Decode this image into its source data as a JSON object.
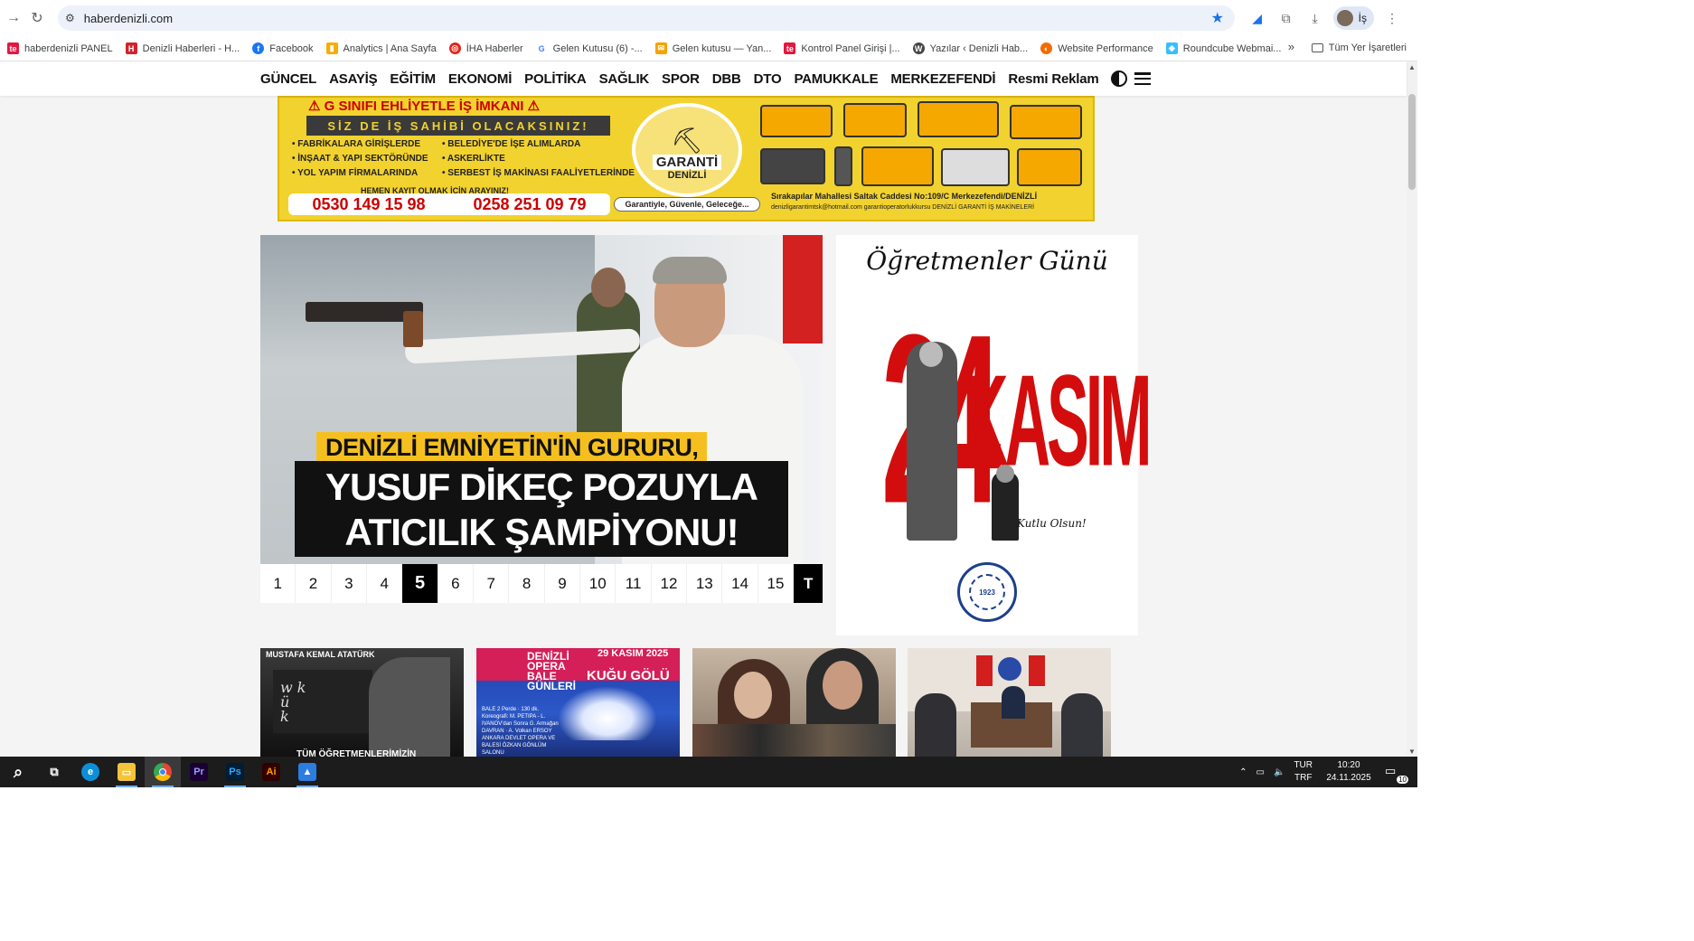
{
  "browser": {
    "url": "haberdenizli.com",
    "profile_label": "İş"
  },
  "bookmarks": {
    "items": [
      {
        "label": "haberdenizli PANEL",
        "icon": "te-icon",
        "color": "#e5173f"
      },
      {
        "label": "Denizli Haberleri - H...",
        "icon": "hd-icon",
        "color": "#d0232e"
      },
      {
        "label": "Facebook",
        "icon": "facebook-icon",
        "color": "#1877f2"
      },
      {
        "label": "Analytics | Ana Sayfa",
        "icon": "analytics-icon",
        "color": "#f9ab00"
      },
      {
        "label": "İHA Haberler",
        "icon": "iha-icon",
        "color": "#e2231a"
      },
      {
        "label": "Gelen Kutusu (6) -...",
        "icon": "google-icon",
        "color": "#4285f4"
      },
      {
        "label": "Gelen kutusu — Yan...",
        "icon": "yandex-mail-icon",
        "color": "#f5a300"
      },
      {
        "label": "Kontrol Panel Girişi |...",
        "icon": "te-icon",
        "color": "#e5173f"
      },
      {
        "label": "Yazılar ‹ Denizli Hab...",
        "icon": "wordpress-icon",
        "color": "#464646"
      },
      {
        "label": "Website Performance",
        "icon": "performance-icon",
        "color": "#f56a00"
      },
      {
        "label": "Roundcube Webmai...",
        "icon": "roundcube-icon",
        "color": "#37beff"
      }
    ],
    "more": "»",
    "all_label": "Tüm Yer İşaretleri"
  },
  "site_nav": {
    "items": [
      "GÜNCEL",
      "ASAYİŞ",
      "EĞİTİM",
      "EKONOMİ",
      "POLİTİKA",
      "SAĞLIK",
      "SPOR",
      "DBB",
      "DTO",
      "PAMUKKALE",
      "MERKEZEFENDİ",
      "Resmi Reklam"
    ]
  },
  "ad_banner": {
    "title": "⚠ G SINIFI EHLİYETLE İŞ İMKANI ⚠",
    "subtitle": "SİZ DE İŞ SAHİBİ OLACAKSINIZ!",
    "list_left": [
      "• FABRİKALARA GİRİŞLERDE",
      "• İNŞAAT & YAPI SEKTÖRÜNDE",
      "• YOL YAPIM FİRMALARINDA"
    ],
    "list_right": [
      "• BELEDİYE'DE İŞE ALIMLARDA",
      "• ASKERLİKTE",
      "• SERBEST İŞ MAKİNASI FAALİYETLERİNDE"
    ],
    "call": "HEMEN KAYIT OLMAK İÇİN ARAYINIZ!",
    "phone1": "0530 149 15 98",
    "phone2": "0258 251 09 79",
    "logo_t1": "GARANTİ",
    "logo_t2": "DENİZLİ",
    "slogan": "Garantiyle, Güvenle, Geleceğe...",
    "address": "Sırakapılar Mahallesi Saltak Caddesi No:109/C Merkezefendi/DENİZLİ",
    "contact": "denizligarantimtsk@hotmail.com   garantioperatorlukkursu   DENİZLİ GARANTİ İŞ MAKİNELERİ"
  },
  "slider": {
    "caption_line1": "DENİZLİ EMNİYETİN'İN GURURU,",
    "caption_line2": "YUSUF DİKEÇ POZUYLA",
    "caption_line3": "ATICILIK ŞAMPİYONU!",
    "pages": [
      "1",
      "2",
      "3",
      "4",
      "5",
      "6",
      "7",
      "8",
      "9",
      "10",
      "11",
      "12",
      "13",
      "14",
      "15"
    ],
    "active_page": "5",
    "last_label": "T"
  },
  "right_ad": {
    "title": "Öğretmenler Günü",
    "day": "24",
    "month": "KASIM",
    "greeting": "Kutlu Olsun!",
    "seal_text": "1923"
  },
  "thumbs": {
    "t1_label": "MUSTAFA KEMAL ATATÜRK",
    "t1_board": "w k\nü\nk",
    "t1_footer": "TÜM ÖĞRETMENLERİMİZİN",
    "t2_opera": "DENİZLİ\nOPERA\nBALE\nGÜNLERİ",
    "t2_date": "29 KASIM 2025",
    "t2_kugu": "KUĞU GÖLÜ",
    "t2_info": "BALE 2 Perde · 130 dk. Koreografi: M. PETIPA - L. IVANOV'dan Sonra G. Armağan DAVRAN · A. Volkan ERSOY ANKARA DEVLET OPERA VE BALESİ ÖZKAN GÖNLÜM SALONU"
  },
  "taskbar": {
    "lang_top": "TUR",
    "lang_bottom": "TRF",
    "time": "10:20",
    "date": "24.11.2025",
    "notif_count": "10"
  }
}
